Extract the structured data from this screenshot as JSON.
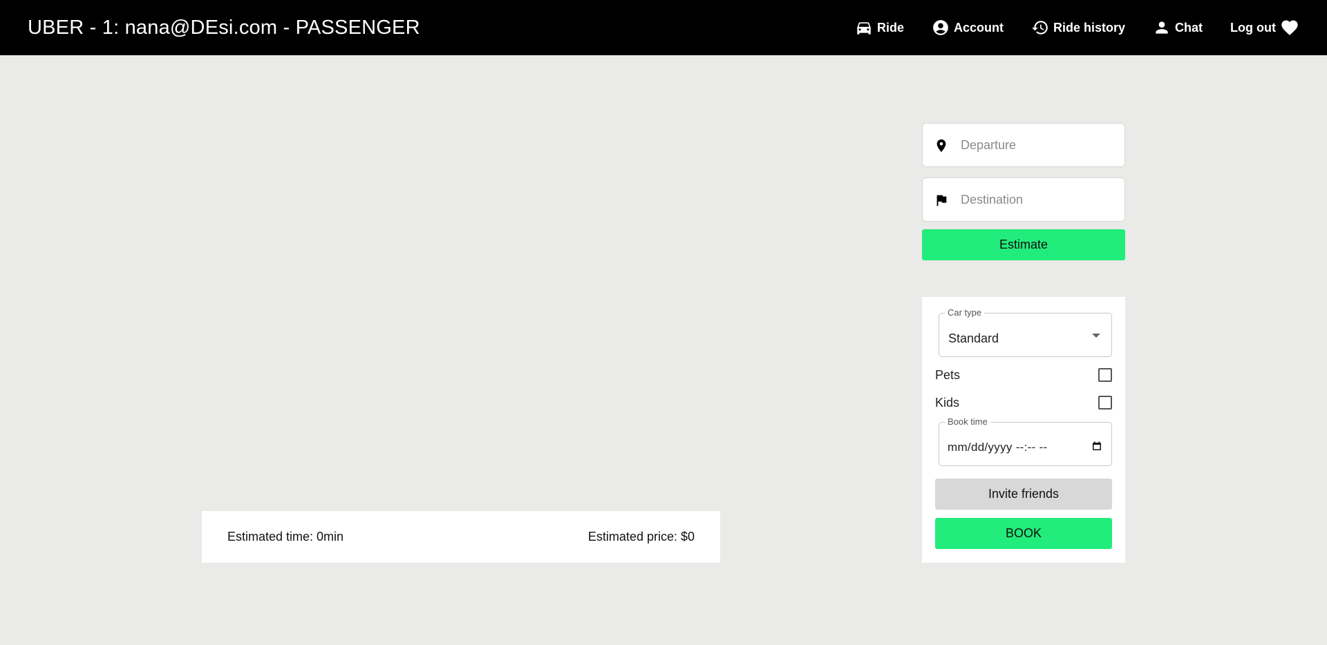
{
  "header": {
    "title": "UBER - 1: nana@DEsi.com - PASSENGER",
    "nav": {
      "ride": "Ride",
      "account": "Account",
      "ride_history": "Ride history",
      "chat": "Chat",
      "logout": "Log out"
    }
  },
  "route": {
    "departure_placeholder": "Departure",
    "departure_value": "",
    "destination_placeholder": "Destination",
    "destination_value": "",
    "estimate_label": "Estimate"
  },
  "options": {
    "car_type_label": "Car type",
    "car_type_value": "Standard",
    "pets_label": "Pets",
    "pets_checked": false,
    "kids_label": "Kids",
    "kids_checked": false,
    "book_time_label": "Book time",
    "book_time_value": "mm/dd/yyyy --:-- --",
    "invite_label": "Invite friends",
    "book_label": "BOOK"
  },
  "estimate": {
    "time_text": "Estimated time: 0min",
    "price_text": "Estimated price: $0"
  },
  "colors": {
    "accent_green": "#22ec7c",
    "header_bg": "#000000",
    "page_bg": "#eaebe8"
  },
  "icons": {
    "ride": "car-icon",
    "account": "account-circle-icon",
    "ride_history": "history-icon",
    "chat": "person-icon",
    "logout": "heart-icon",
    "departure": "location-pin-icon",
    "destination": "flag-icon"
  }
}
